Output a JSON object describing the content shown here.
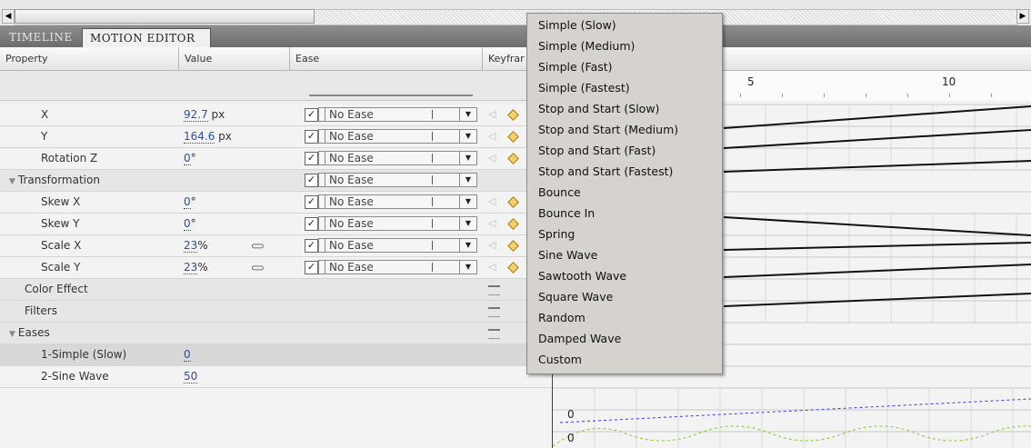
{
  "tabs": {
    "timeline": "TIMELINE",
    "motion_editor": "MOTION EDITOR"
  },
  "columns": {
    "property": "Property",
    "value": "Value",
    "ease": "Ease",
    "keyframe": "Keyfrar"
  },
  "ruler": {
    "labels": [
      "5",
      "10"
    ]
  },
  "rows": [
    {
      "name": "X",
      "value": "92.7",
      "unit": " px",
      "ease": "No Ease"
    },
    {
      "name": "Y",
      "value": "164.6",
      "unit": " px",
      "ease": "No Ease"
    },
    {
      "name": "Rotation Z",
      "value": "0",
      "unit": "°",
      "ease": "No Ease"
    },
    {
      "name": "Transformation",
      "ease": "No Ease"
    },
    {
      "name": "Skew X",
      "value": "0",
      "unit": "°",
      "ease": "No Ease"
    },
    {
      "name": "Skew Y",
      "value": "0",
      "unit": "°",
      "ease": "No Ease"
    },
    {
      "name": "Scale X",
      "value": "23",
      "unit": "%",
      "ease": "No Ease"
    },
    {
      "name": "Scale Y",
      "value": "23",
      "unit": "%",
      "ease": "No Ease"
    },
    {
      "name": "Color Effect"
    },
    {
      "name": "Filters"
    },
    {
      "name": "Eases"
    },
    {
      "name": "1-Simple (Slow)",
      "value": "0"
    },
    {
      "name": "2-Sine Wave",
      "value": "50"
    }
  ],
  "graph_labels": [
    "0",
    "0"
  ],
  "ease_menu": {
    "items": [
      "Simple (Slow)",
      "Simple (Medium)",
      "Simple (Fast)",
      "Simple (Fastest)",
      "Stop and Start (Slow)",
      "Stop and Start (Medium)",
      "Stop and Start (Fast)",
      "Stop and Start (Fastest)",
      "Bounce",
      "Bounce In",
      "Spring",
      "Sine Wave",
      "Sawtooth Wave",
      "Square Wave",
      "Random",
      "Damped Wave",
      "Custom"
    ]
  },
  "icons": {
    "keyframe": "diamond-icon",
    "link": "chain-link-icon",
    "add": "plus-icon"
  },
  "colors": {
    "playhead": "#d00000",
    "value_link": "#2a4fa0",
    "keyframe": "#f2d070"
  }
}
